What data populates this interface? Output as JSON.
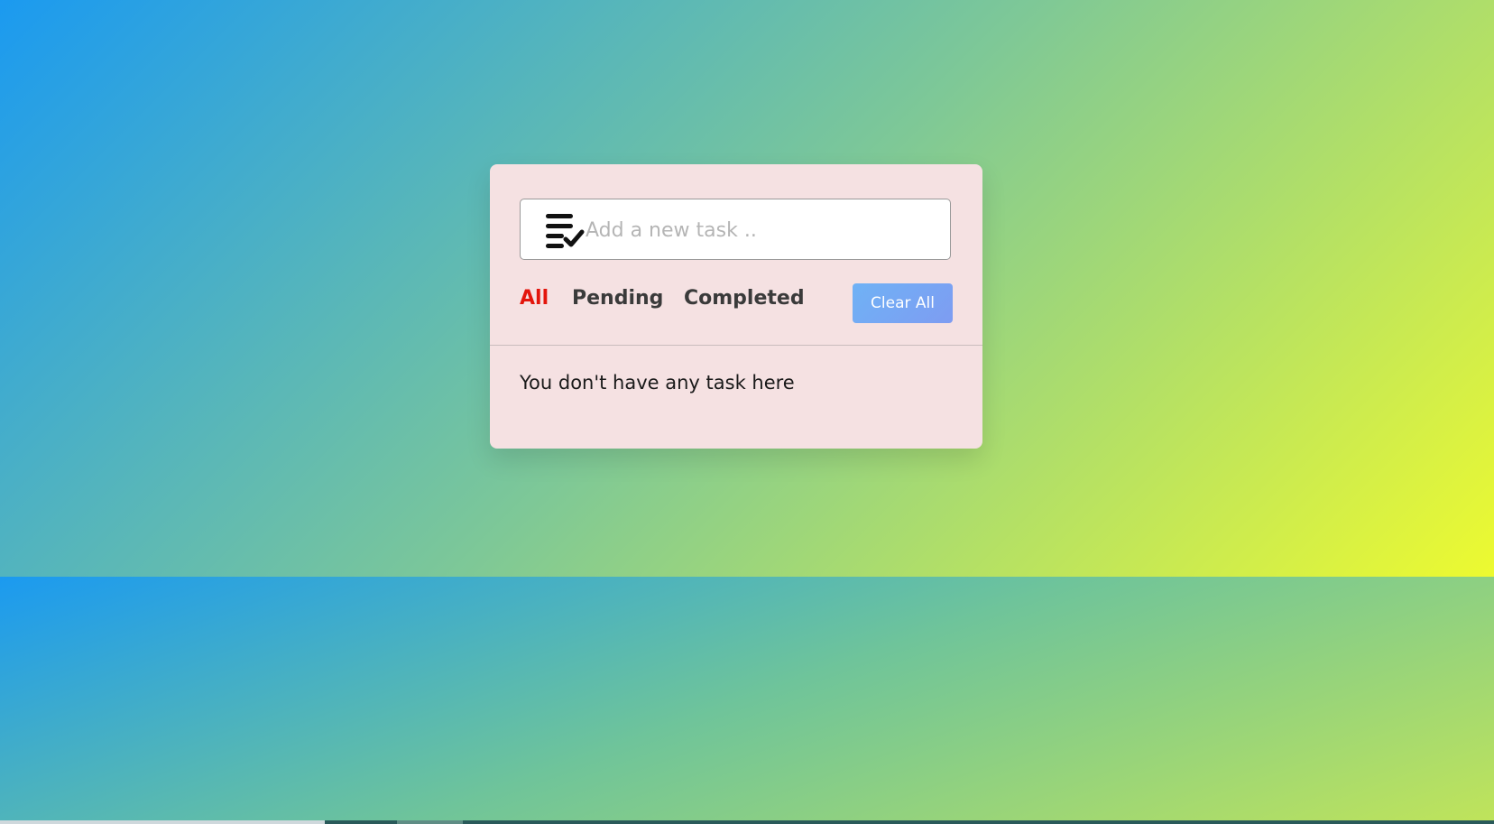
{
  "colors": {
    "card_background": "#f5e1e2",
    "active_filter": "#e3150c",
    "filter_text": "#3a3a3a",
    "clear_button_start": "#6fb2f5",
    "clear_button_end": "#7e9cf2"
  },
  "input": {
    "icon": "task-list-check-icon",
    "placeholder": "Add a new task .."
  },
  "filters": {
    "all": "All",
    "pending": "Pending",
    "completed": "Completed",
    "active": "All"
  },
  "clear_all_label": "Clear All",
  "task_list": {
    "empty_message": "You don't have any task here"
  }
}
